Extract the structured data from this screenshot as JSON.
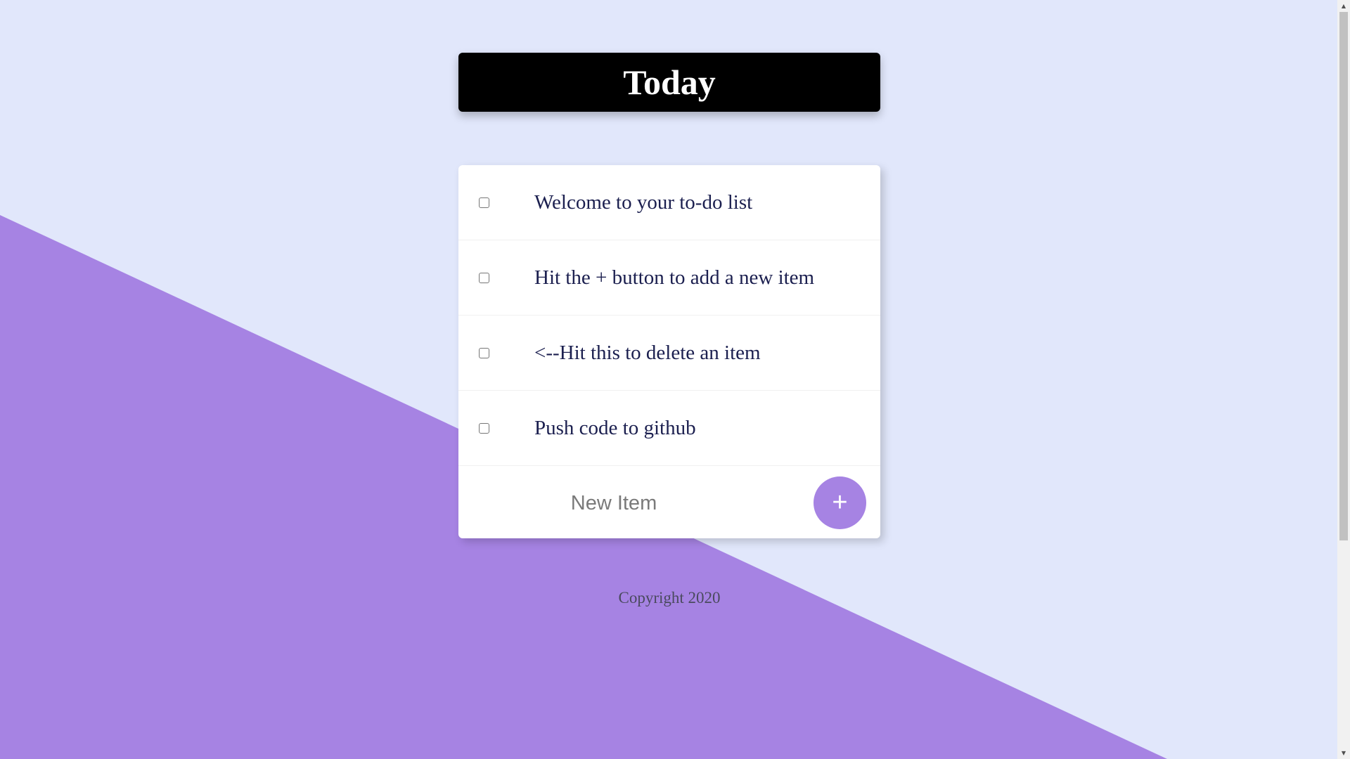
{
  "colors": {
    "background": "#E1E7FB",
    "accent": "#A683E3",
    "heading_bg": "#000000",
    "card_bg": "#FFFFFF",
    "item_text": "#1B1F4F"
  },
  "header": {
    "title": "Today"
  },
  "list": {
    "items": [
      {
        "text": "Welcome to your to-do list",
        "checked": false
      },
      {
        "text": "Hit the + button to add a new item",
        "checked": false
      },
      {
        "text": "<--Hit this to delete an item",
        "checked": false
      },
      {
        "text": "Push code to github",
        "checked": false
      }
    ]
  },
  "new_item": {
    "placeholder": "New Item",
    "value": "",
    "add_label": "+",
    "add_icon": "plus-icon"
  },
  "footer": {
    "text": "Copyright 2020"
  }
}
